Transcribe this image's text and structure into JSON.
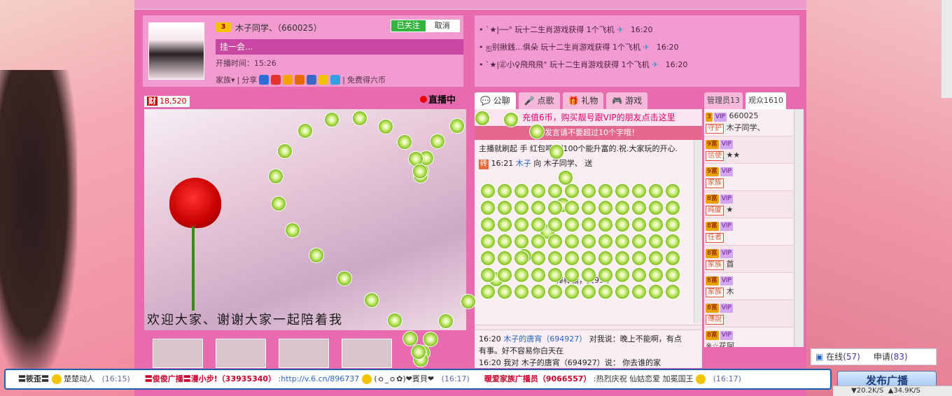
{
  "anchor": {
    "level": "3",
    "name": "木子同学、（660025）",
    "follow_label": "已关注",
    "cancel_label": "取消",
    "status": "挂一会...",
    "live_time": "开播时间：15:26",
    "family_label": "家族▾",
    "share_label": "分享",
    "free_coins_label": "免费得六币"
  },
  "notices": [
    {
      "user": "`★|──°",
      "text": "玩十二生肖游戏获得 1个飞机",
      "time": "16:20"
    },
    {
      "user": "ஐ别揪銭…俱朵",
      "text": "玩十二生肖游戏获得 1个飞机",
      "time": "16:20"
    },
    {
      "user": "`★|㊣小♀飛飛飛°",
      "text": "玩十二生肖游戏获得 1个飞机",
      "time": "16:20"
    }
  ],
  "video": {
    "wealth_label": "财",
    "wealth_value": "18,520",
    "live_label": "直播中",
    "caption": "欢迎大家、谢谢大家一起陪着我"
  },
  "chat_tabs": [
    "公聊",
    "点歌",
    "礼物",
    "游戏"
  ],
  "chat": {
    "promo": "充值6币，购买靓号跟VIP的朋友点击这里",
    "warning": "发言请不要超过10个字哦！",
    "message1": "主播就刷起 手 红包吧.刷100个能升富的.祝.大家玩的开心.",
    "gift_tag": "砖",
    "gift_time": "16:21",
    "gift_from": "木子",
    "gift_to_text": "向 木子同学、 送",
    "gift_summary": "棒棒糖，共99个",
    "lower1_time": "16:20",
    "lower1_user": "木子的唐宵（694927）",
    "lower1_text": "对我说：晚上不能啊，有点有事。好不容易你白天在",
    "lower2_time": "16:20",
    "lower2_text": "我对 木子的唐宵（694927）说：  你去谁的家"
  },
  "user_tabs": {
    "admins": "管理员13",
    "audience": "观众1610"
  },
  "users": [
    {
      "level": "3",
      "vip": "VIP",
      "id": "660025",
      "role": "守护",
      "name": "木子同学、"
    },
    {
      "level": "9富",
      "vip": "VIP",
      "id": "",
      "role": "信使",
      "name": "★★"
    },
    {
      "level": "9富",
      "vip": "VIP",
      "id": "",
      "role": "家族",
      "name": ""
    },
    {
      "level": "8富",
      "vip": "VIP",
      "id": "",
      "role": "纯厦",
      "name": "★"
    },
    {
      "level": "8富",
      "vip": "VIP",
      "id": "",
      "role": "任者",
      "name": ""
    },
    {
      "level": "8富",
      "vip": "VIP",
      "id": "",
      "role": "家族",
      "name": "首"
    },
    {
      "level": "8富",
      "vip": "VIP",
      "id": "",
      "role": "家族",
      "name": "木"
    },
    {
      "level": "8富",
      "vip": "VIP",
      "id": "",
      "role": "傳說",
      "name": ""
    },
    {
      "level": "8富",
      "vip": "VIP",
      "id": "",
      "role": "",
      "name": "※☆花阿"
    }
  ],
  "online": {
    "label": "在线",
    "count": "(57)",
    "apply_label": "申请",
    "apply_count": "(83)"
  },
  "marquee": [
    {
      "user": "〓筱歪〓",
      "text": "楚楚动人",
      "time": "(16:15)"
    },
    {
      "user": "〓俊俊广播〓漫小步!（33935340）",
      "text": ":http://v.6.cn/896737",
      "extra": "(ｏ_ｏ✿)❤賓貝❤",
      "time": "(16:17)"
    },
    {
      "user": "暖爱家族广播员（9066557）",
      "text": ":热烈庆祝 仙姑恋爱 加冕国王",
      "time": "(16:17)"
    }
  ],
  "broadcast_label": "发布广播",
  "net": {
    "down": "20.2K/S",
    "up": "34.9K/S"
  },
  "colors": {
    "room": "#e86bb0",
    "panel": "#f29bd0",
    "status_bar": "#c946a3",
    "follow": "#35b53e"
  }
}
